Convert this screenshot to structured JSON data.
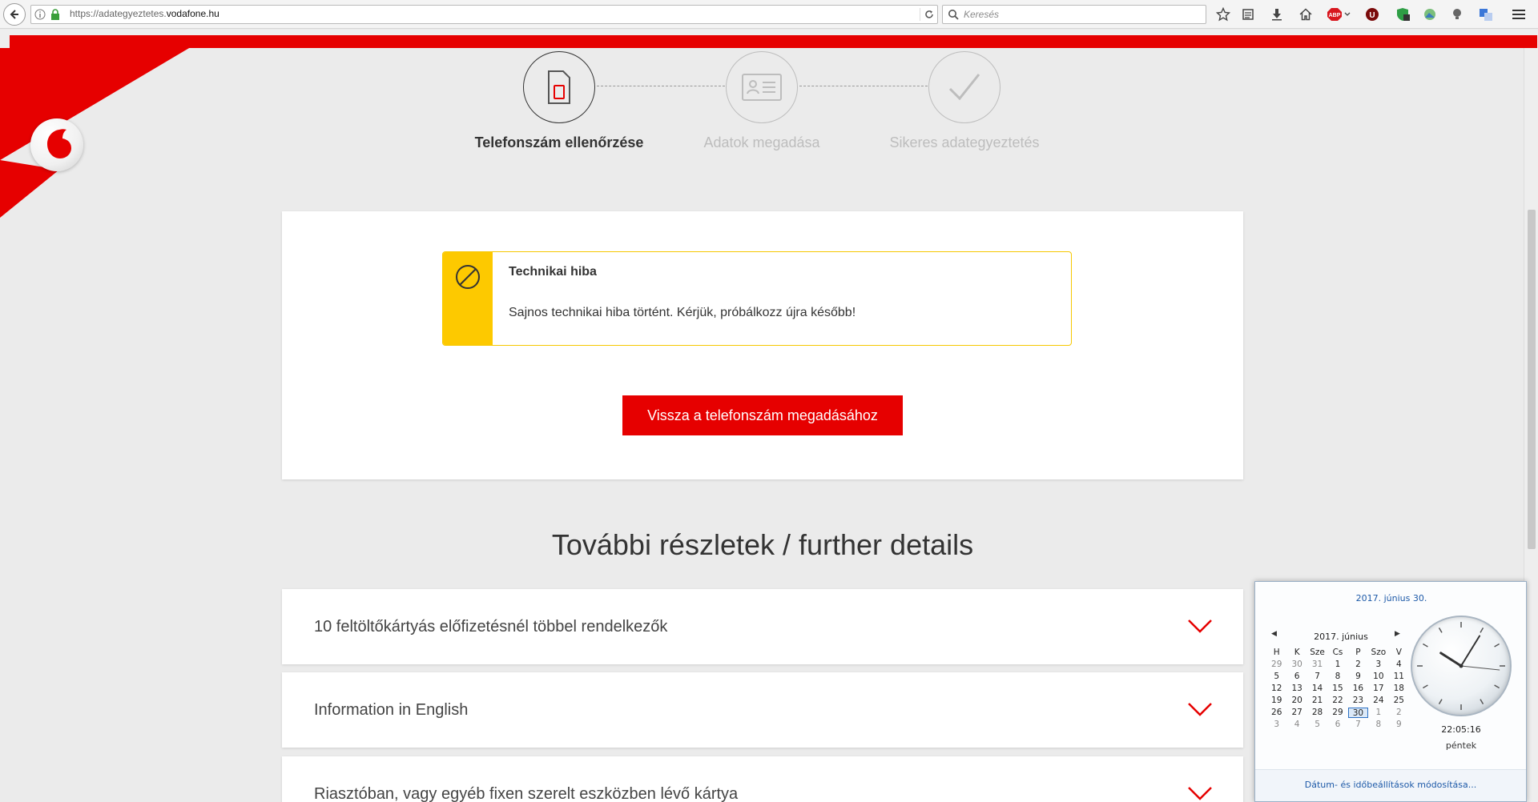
{
  "browser": {
    "url_prefix": "https://adategyeztetes.",
    "url_domain": "vodafone.hu",
    "search_placeholder": "Keresés",
    "abp_label": "ABP",
    "ublock_label": "U"
  },
  "steps": [
    {
      "label": "Telefonszám ellenőrzése",
      "active": true
    },
    {
      "label": "Adatok megadása",
      "active": false
    },
    {
      "label": "Sikeres adategyeztetés",
      "active": false
    }
  ],
  "alert": {
    "title": "Technikai hiba",
    "message": "Sajnos technikai hiba történt. Kérjük, próbálkozz újra később!"
  },
  "back_button_label": "Vissza a telefonszám megadásához",
  "further_title": "További részletek / further details",
  "accordion": [
    {
      "label": "10 feltöltőkártyás előfizetésnél többel rendelkezők"
    },
    {
      "label": "Information in English"
    },
    {
      "label": "Riasztóban, vagy egyéb fixen szerelt eszközben lévő kártya"
    }
  ],
  "calendar": {
    "full_date": "2017. június 30.",
    "month_label": "2017. június",
    "weekdays": [
      "H",
      "K",
      "Sze",
      "Cs",
      "P",
      "Szo",
      "V"
    ],
    "days": [
      [
        "29",
        "30",
        "31",
        "1",
        "2",
        "3",
        "4"
      ],
      [
        "5",
        "6",
        "7",
        "8",
        "9",
        "10",
        "11"
      ],
      [
        "12",
        "13",
        "14",
        "15",
        "16",
        "17",
        "18"
      ],
      [
        "19",
        "20",
        "21",
        "22",
        "23",
        "24",
        "25"
      ],
      [
        "26",
        "27",
        "28",
        "29",
        "30",
        "1",
        "2"
      ],
      [
        "3",
        "4",
        "5",
        "6",
        "7",
        "8",
        "9"
      ]
    ],
    "today": "30",
    "time": "22:05:16",
    "weekday_name": "péntek",
    "settings_link": "Dátum- és időbeállítások módosítása..."
  },
  "colors": {
    "brand_red": "#e60000",
    "alert_yellow": "#fdc900"
  }
}
